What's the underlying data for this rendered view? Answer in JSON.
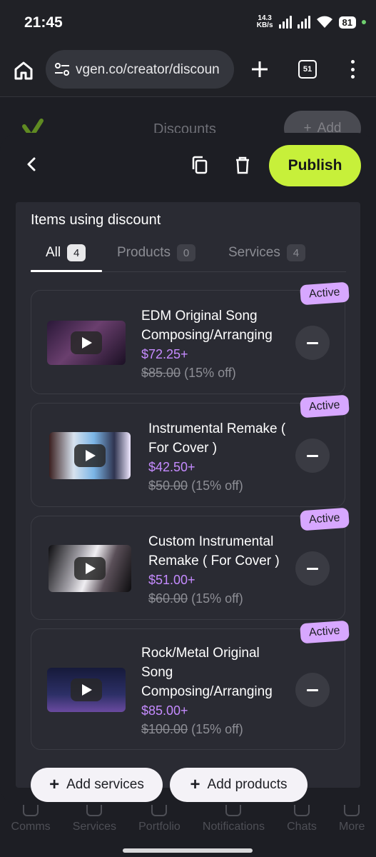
{
  "status_bar": {
    "time": "21:45",
    "net_speed_value": "14.3",
    "net_speed_unit": "KB/s",
    "battery": "81"
  },
  "browser": {
    "url": "vgen.co/creator/discoun",
    "tab_count": "51"
  },
  "background_page": {
    "title": "Discounts",
    "add_label": "Add",
    "nav": [
      "Comms",
      "Services",
      "Portfolio",
      "Notifications",
      "Chats",
      "More"
    ]
  },
  "sheet": {
    "publish_label": "Publish",
    "section_title": "Items using discount",
    "tabs": [
      {
        "label": "All",
        "count": "4"
      },
      {
        "label": "Products",
        "count": "0"
      },
      {
        "label": "Services",
        "count": "4"
      }
    ],
    "items": [
      {
        "name": "EDM Original Song Composing/Arranging",
        "price": "$72.25+",
        "old_price": "$85.00",
        "off": "(15% off)",
        "status": "Active"
      },
      {
        "name": "Instrumental Remake ( For Cover )",
        "price": "$42.50+",
        "old_price": "$50.00",
        "off": "(15% off)",
        "status": "Active"
      },
      {
        "name": "Custom Instrumental Remake ( For Cover )",
        "price": "$51.00+",
        "old_price": "$60.00",
        "off": "(15% off)",
        "status": "Active"
      },
      {
        "name": "Rock/Metal Original Song Composing/Arranging",
        "price": "$85.00+",
        "old_price": "$100.00",
        "off": "(15% off)",
        "status": "Active"
      }
    ],
    "add_services_label": "Add services",
    "add_products_label": "Add products"
  },
  "colors": {
    "accent_lime": "#c7f03a",
    "price_purple": "#c58bff",
    "badge_purple": "#d7a7ff"
  }
}
